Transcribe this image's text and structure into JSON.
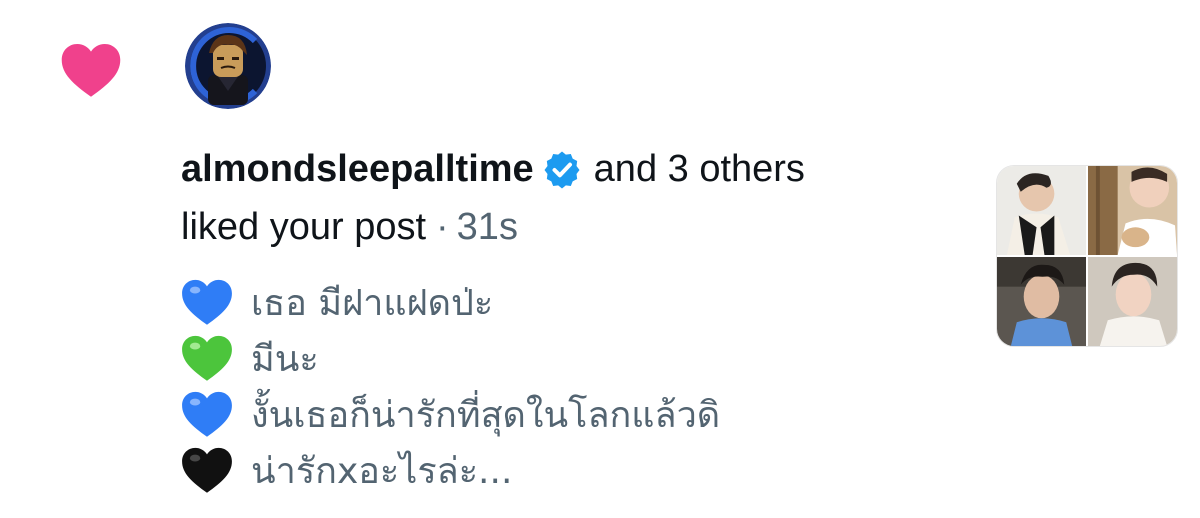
{
  "notification": {
    "type_icon": "heart-icon",
    "accent_color": "#f91880",
    "verified_color": "#1d9bf0",
    "username": "almondsleepalltime",
    "others_text": "and 3 others",
    "action_text": "liked your post",
    "separator": "·",
    "timestamp": "31s"
  },
  "post": {
    "lines": [
      {
        "emoji": "blue-heart",
        "color": "#2f7df6",
        "text": "เธอ มีฝาแฝดป่ะ"
      },
      {
        "emoji": "green-heart",
        "color": "#4cc53c",
        "text": "มีนะ"
      },
      {
        "emoji": "blue-heart",
        "color": "#2f7df6",
        "text": "งั้นเธอก็น่ารักที่สุดในโลกแล้วดิ"
      },
      {
        "emoji": "black-heart",
        "color": "#111111",
        "text": "น่ารักxอะไรล่ะ..."
      }
    ]
  }
}
